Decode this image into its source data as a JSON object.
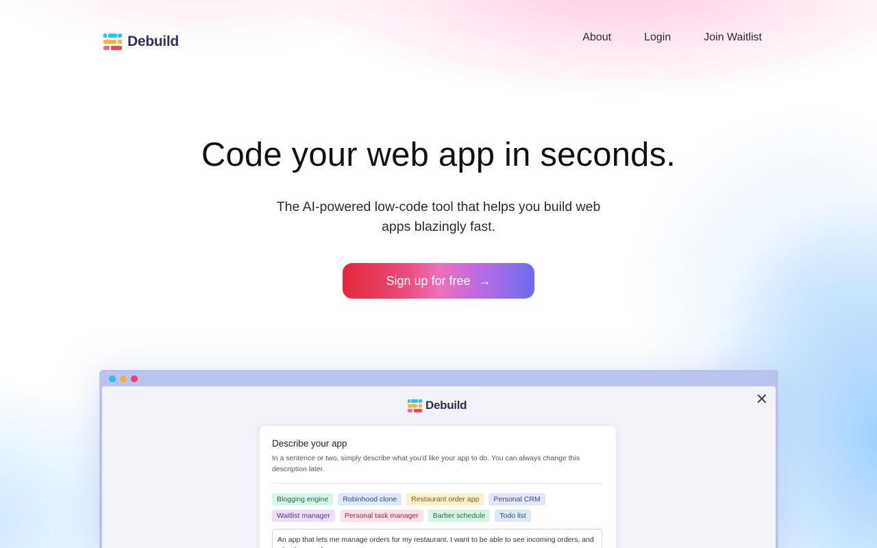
{
  "brand": {
    "name": "Debuild",
    "logo_colors": [
      "#29c3f0",
      "#fbb33c",
      "#f6454f",
      "#ff5f9e"
    ]
  },
  "nav": {
    "items": [
      {
        "label": "About"
      },
      {
        "label": "Login"
      },
      {
        "label": "Join Waitlist"
      }
    ]
  },
  "hero": {
    "title": "Code your web app in seconds.",
    "subtitle": "The AI-powered low-code tool that helps you build web apps blazingly fast.",
    "cta_label": "Sign up for free",
    "cta_arrow": "→"
  },
  "preview": {
    "window_dots": [
      "#1fc4f0",
      "#fbb12f",
      "#f23d6a"
    ],
    "close_icon": "close-icon",
    "logo_text": "Debuild",
    "card": {
      "title": "Describe your app",
      "description": "In a sentence or two, simply describe what you'd like your app to do. You can always change this description later.",
      "chips": [
        {
          "label": "Blogging engine",
          "bg": "#d8f6e6",
          "fg": "#1f6b45"
        },
        {
          "label": "Robinhood clone",
          "bg": "#dde8fb",
          "fg": "#2a4f8a"
        },
        {
          "label": "Restaurant order app",
          "bg": "#fdf0cf",
          "fg": "#8a5a10"
        },
        {
          "label": "Personal CRM",
          "bg": "#e1e6fb",
          "fg": "#3a4790"
        },
        {
          "label": "Waitlist manager",
          "bg": "#eddffb",
          "fg": "#5b2f92"
        },
        {
          "label": "Personal task manager",
          "bg": "#fde2ea",
          "fg": "#9a2448"
        },
        {
          "label": "Barber schedule",
          "bg": "#d8f6e6",
          "fg": "#1f6b45"
        },
        {
          "label": "Todo list",
          "bg": "#dde8fb",
          "fg": "#2a4f8a"
        }
      ],
      "textarea_value": "An app that lets me manage orders for my restaurant. I want to be able to see incoming orders, and who they are from."
    }
  }
}
